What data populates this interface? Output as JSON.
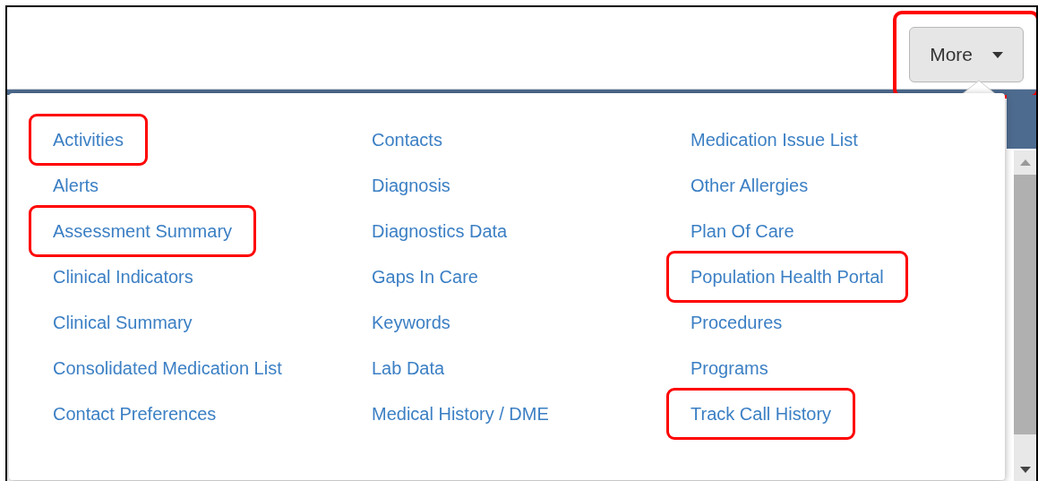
{
  "toolbar": {
    "more_button": {
      "label": "More",
      "highlighted": true
    }
  },
  "menu": {
    "columns": [
      [
        {
          "label": "Activities",
          "highlighted": true
        },
        {
          "label": "Alerts",
          "highlighted": false
        },
        {
          "label": "Assessment Summary",
          "highlighted": true
        },
        {
          "label": "Clinical Indicators",
          "highlighted": false
        },
        {
          "label": "Clinical Summary",
          "highlighted": false
        },
        {
          "label": "Consolidated Medication List",
          "highlighted": false
        },
        {
          "label": "Contact Preferences",
          "highlighted": false
        }
      ],
      [
        {
          "label": "Contacts",
          "highlighted": false
        },
        {
          "label": "Diagnosis",
          "highlighted": false
        },
        {
          "label": "Diagnostics Data",
          "highlighted": false
        },
        {
          "label": "Gaps In Care",
          "highlighted": false
        },
        {
          "label": "Keywords",
          "highlighted": false
        },
        {
          "label": "Lab Data",
          "highlighted": false
        },
        {
          "label": "Medical History / DME",
          "highlighted": false
        }
      ],
      [
        {
          "label": "Medication Issue List",
          "highlighted": false
        },
        {
          "label": "Other Allergies",
          "highlighted": false
        },
        {
          "label": "Plan Of Care",
          "highlighted": false
        },
        {
          "label": "Population Health Portal",
          "highlighted": true
        },
        {
          "label": "Procedures",
          "highlighted": false
        },
        {
          "label": "Programs",
          "highlighted": false
        },
        {
          "label": "Track Call History",
          "highlighted": true
        }
      ]
    ]
  }
}
